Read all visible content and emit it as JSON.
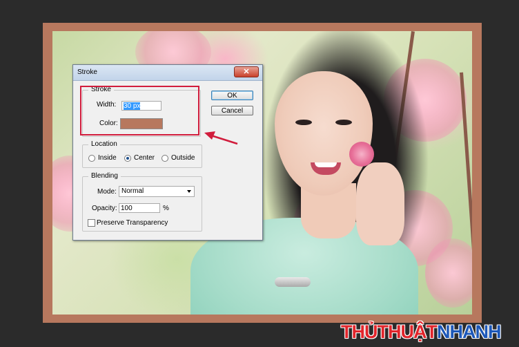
{
  "colors": {
    "background": "#2b2b2b",
    "stroke_frame": "#b7785e",
    "annotation_red": "#d11c3c",
    "watermark_red": "#e1252b",
    "watermark_blue": "#1c57b8"
  },
  "dialog": {
    "title": "Stroke",
    "close_symbol": "✕",
    "ok_label": "OK",
    "cancel_label": "Cancel",
    "stroke": {
      "legend": "Stroke",
      "width_label": "Width:",
      "width_value": "30 px",
      "color_label": "Color:",
      "color_value": "#b7785e"
    },
    "location": {
      "legend": "Location",
      "options": [
        "Inside",
        "Center",
        "Outside"
      ],
      "selected": "Center"
    },
    "blending": {
      "legend": "Blending",
      "mode_label": "Mode:",
      "mode_value": "Normal",
      "opacity_label": "Opacity:",
      "opacity_value": "100",
      "opacity_unit": "%",
      "preserve_label": "Preserve Transparency",
      "preserve_checked": false
    }
  },
  "watermark": {
    "part1": "THỦTHUẬT",
    "part2": "NHANH"
  }
}
